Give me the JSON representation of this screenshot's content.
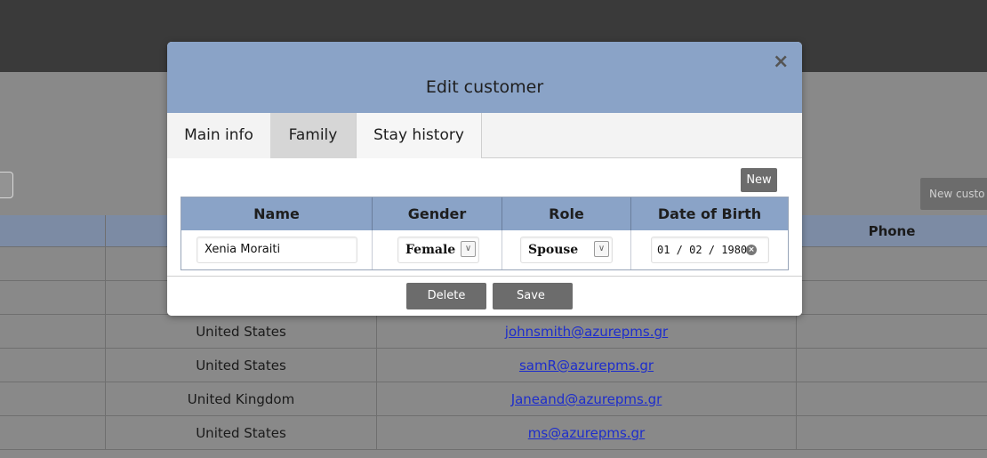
{
  "background": {
    "new_button_label": "New custo",
    "table": {
      "header_phone": "Phone",
      "rows": [
        {
          "country": "United States",
          "email": "johnsmith@azurepms.gr"
        },
        {
          "country": "United States",
          "email": "samR@azurepms.gr"
        },
        {
          "country": "United Kingdom",
          "email": "Janeand@azurepms.gr"
        },
        {
          "country": "United States",
          "email": "ms@azurepms.gr"
        }
      ]
    }
  },
  "modal": {
    "title": "Edit customer",
    "close_symbol": "×",
    "tabs": [
      {
        "label": "Main info"
      },
      {
        "label": "Family",
        "active": true
      },
      {
        "label": "Stay history"
      }
    ],
    "new_button_label": "New",
    "family_table": {
      "headers": [
        "Name",
        "Gender",
        "Role",
        "Date of Birth"
      ],
      "row": {
        "name": "Xenia Moraiti",
        "gender": "Female",
        "role": "Spouse",
        "date_of_birth": "01 / 02 / 1980"
      }
    },
    "footer": {
      "delete_label": "Delete",
      "save_label": "Save"
    }
  },
  "icons": {
    "close": "close-icon",
    "chevron": "chevron-down-icon",
    "clear": "clear-circle-icon"
  },
  "colors": {
    "header_blue": "#8aa3c7",
    "button_gray": "#6c6c6c",
    "link_blue": "#1d2dcc",
    "topbar": "#3a3a3a",
    "overlay": "#898989"
  }
}
